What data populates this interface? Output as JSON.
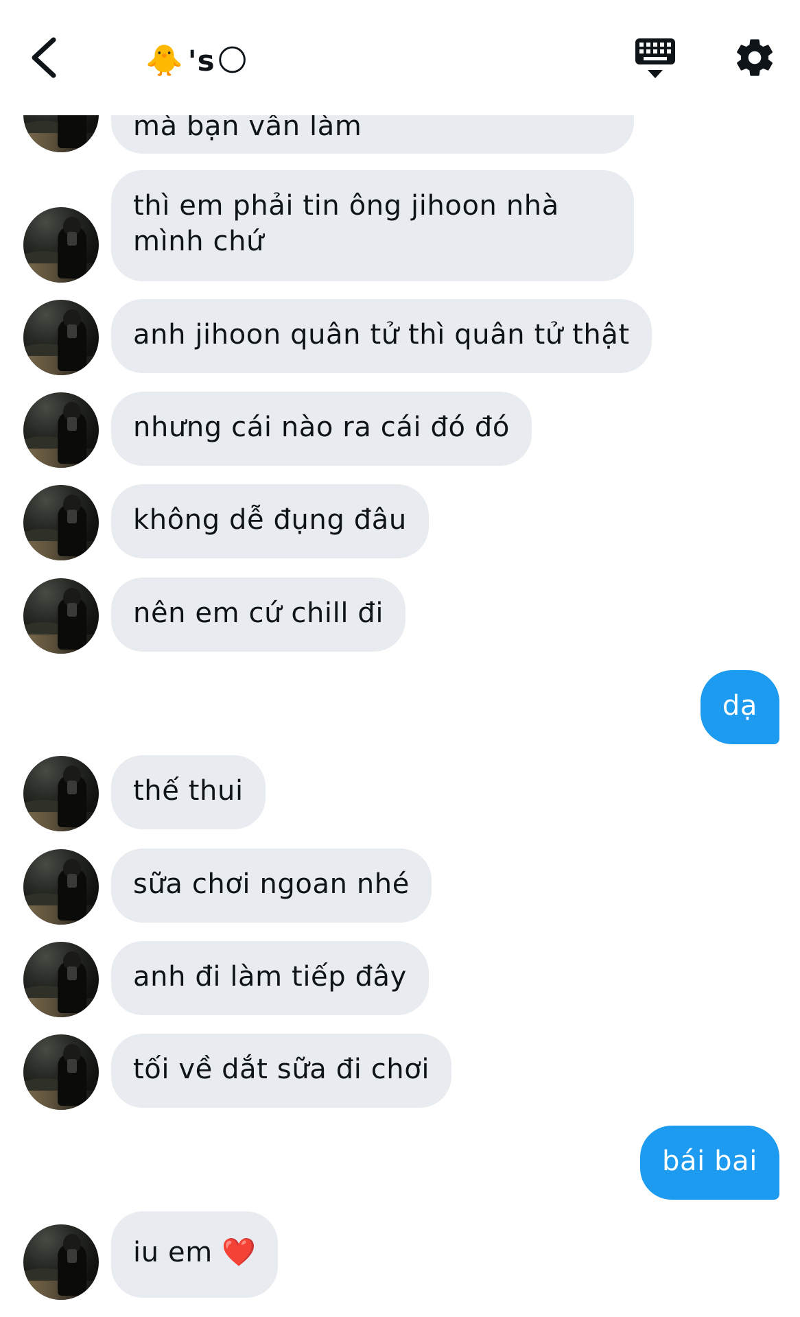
{
  "header": {
    "title_emoji_left": "🐥",
    "title_text": "'s",
    "title_emoji_right": "🌕"
  },
  "messages": [
    {
      "from": "them",
      "text": "mà bạn vẫn làm"
    },
    {
      "from": "them",
      "text": "thì em phải tin ông jihoon nhà mình chứ"
    },
    {
      "from": "them",
      "text": "anh jihoon quân tử thì quân tử thật"
    },
    {
      "from": "them",
      "text": "nhưng cái nào ra cái đó đó"
    },
    {
      "from": "them",
      "text": "không dễ đụng đâu"
    },
    {
      "from": "them",
      "text": "nên em cứ chill đi"
    },
    {
      "from": "me",
      "text": "dạ"
    },
    {
      "from": "them",
      "text": "thế thui"
    },
    {
      "from": "them",
      "text": "sữa chơi ngoan nhé"
    },
    {
      "from": "them",
      "text": "anh đi làm tiếp đây"
    },
    {
      "from": "them",
      "text": "tối về dắt sữa đi chơi"
    },
    {
      "from": "me",
      "text": "bái bai"
    },
    {
      "from": "them",
      "text": "iu em ❤️"
    }
  ],
  "icons": {
    "back": "chevron-left-icon",
    "keyboard": "keyboard-icon",
    "settings": "gear-icon"
  },
  "colors": {
    "incoming_bubble": "#e8ebef",
    "outgoing_bubble": "#1d9bf0",
    "text": "#0f1419"
  }
}
